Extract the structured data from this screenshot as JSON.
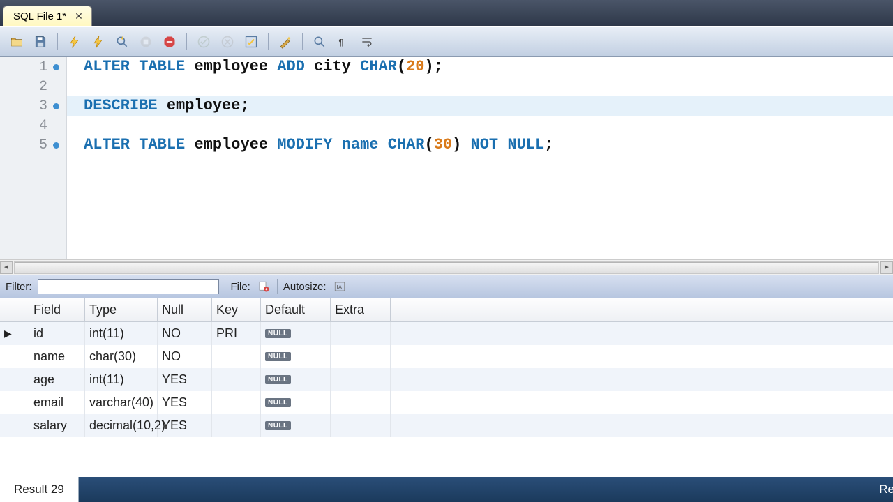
{
  "tab": {
    "title": "SQL File 1*"
  },
  "editor": {
    "lines": [
      {
        "n": 1,
        "marker": true,
        "tokens": [
          {
            "t": "ALTER",
            "c": "kw"
          },
          {
            "t": " ",
            "c": ""
          },
          {
            "t": "TABLE",
            "c": "kw"
          },
          {
            "t": " ",
            "c": ""
          },
          {
            "t": "employee",
            "c": "ident"
          },
          {
            "t": " ",
            "c": ""
          },
          {
            "t": "ADD",
            "c": "kw"
          },
          {
            "t": " ",
            "c": ""
          },
          {
            "t": "city",
            "c": "ident"
          },
          {
            "t": " ",
            "c": ""
          },
          {
            "t": "CHAR",
            "c": "dt"
          },
          {
            "t": "(",
            "c": "pun"
          },
          {
            "t": "20",
            "c": "num"
          },
          {
            "t": ")",
            "c": "pun"
          },
          {
            "t": ";",
            "c": "pun"
          }
        ]
      },
      {
        "n": 2,
        "marker": false,
        "tokens": []
      },
      {
        "n": 3,
        "marker": true,
        "highlight": true,
        "tokens": [
          {
            "t": "DESCRIBE",
            "c": "kw"
          },
          {
            "t": " ",
            "c": ""
          },
          {
            "t": "employee",
            "c": "ident"
          },
          {
            "t": ";",
            "c": "pun"
          }
        ]
      },
      {
        "n": 4,
        "marker": false,
        "tokens": []
      },
      {
        "n": 5,
        "marker": true,
        "tokens": [
          {
            "t": "ALTER",
            "c": "kw"
          },
          {
            "t": " ",
            "c": ""
          },
          {
            "t": "TABLE",
            "c": "kw"
          },
          {
            "t": " ",
            "c": ""
          },
          {
            "t": "employee",
            "c": "ident"
          },
          {
            "t": " ",
            "c": ""
          },
          {
            "t": "MODIFY",
            "c": "kw"
          },
          {
            "t": " ",
            "c": ""
          },
          {
            "t": "name",
            "c": "kw"
          },
          {
            "t": " ",
            "c": ""
          },
          {
            "t": "CHAR",
            "c": "dt"
          },
          {
            "t": "(",
            "c": "pun"
          },
          {
            "t": "30",
            "c": "num"
          },
          {
            "t": ")",
            "c": "pun"
          },
          {
            "t": " ",
            "c": ""
          },
          {
            "t": "NOT",
            "c": "kw"
          },
          {
            "t": " ",
            "c": ""
          },
          {
            "t": "NULL",
            "c": "kw"
          },
          {
            "t": ";",
            "c": "pun"
          }
        ]
      }
    ]
  },
  "filter": {
    "label": "Filter:",
    "file_label": "File:",
    "autosize_label": "Autosize:"
  },
  "grid": {
    "headers": [
      "Field",
      "Type",
      "Null",
      "Key",
      "Default",
      "Extra"
    ],
    "rows": [
      {
        "selected": true,
        "field": "id",
        "type": "int(11)",
        "null": "NO",
        "key": "PRI",
        "default": "NULL",
        "extra": ""
      },
      {
        "selected": false,
        "field": "name",
        "type": "char(30)",
        "null": "NO",
        "key": "",
        "default": "NULL",
        "extra": ""
      },
      {
        "selected": false,
        "field": "age",
        "type": "int(11)",
        "null": "YES",
        "key": "",
        "default": "NULL",
        "extra": ""
      },
      {
        "selected": false,
        "field": "email",
        "type": "varchar(40)",
        "null": "YES",
        "key": "",
        "default": "NULL",
        "extra": ""
      },
      {
        "selected": false,
        "field": "salary",
        "type": "decimal(10,2)",
        "null": "YES",
        "key": "",
        "default": "NULL",
        "extra": ""
      }
    ]
  },
  "status": {
    "result_tab": "Result 29",
    "right": "Re"
  }
}
